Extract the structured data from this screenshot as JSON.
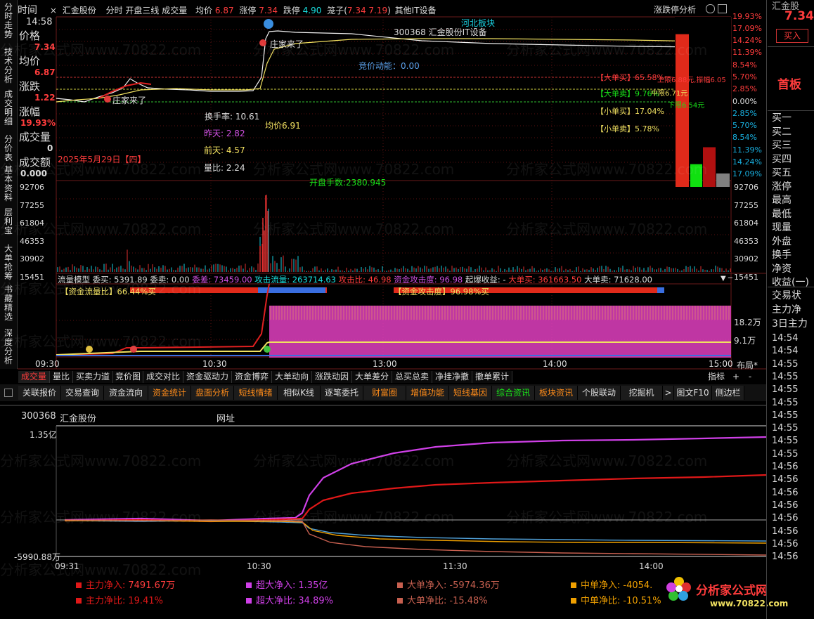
{
  "left_tabs": [
    "分时走势",
    "技术分析",
    "成交明细",
    "分价表",
    "基本资料",
    "层利宝",
    "大单抢筹",
    "书藏精选",
    "深度分析"
  ],
  "header": {
    "time_label": "时间",
    "close_icon": "×",
    "stock_name": "汇金股份",
    "chart_mode": "分时 开盘三线 成交量",
    "avg_label": "均价",
    "avg_value": "6.87",
    "limit_up_label": "涨停",
    "limit_up_value": "7.34",
    "limit_down_label": "跌停",
    "limit_down_value": "4.90",
    "cage_label": "笼子(",
    "cage_values": "7.34 7.19",
    "cage_close": ")",
    "sector": "其他IT设备",
    "right_label": "涨跌停分析"
  },
  "left_panel": {
    "time": "14:58",
    "price_label": "价格",
    "price": "7.34",
    "avg_label": "均价",
    "avg": "6.87",
    "change_label": "涨跌",
    "change": "1.22",
    "pct_label": "涨幅",
    "pct": "19.93%",
    "vol_label": "成交量",
    "vol": "0",
    "amt_label": "成交额",
    "amt": "0.000"
  },
  "price_chart": {
    "y_left": [
      "7.34",
      "6.87",
      "1.22"
    ],
    "y_right": [
      "19.93%",
      "17.09%",
      "14.24%",
      "11.39%",
      "8.54%",
      "5.70%",
      "2.85%",
      "0.00%",
      "2.85%",
      "5.70%",
      "8.54%",
      "11.39%",
      "14.24%",
      "17.09%"
    ],
    "code_label": "300368  汇金股份IT设备",
    "sector_label": "河北板块",
    "zhuangjia1": "庄家来了",
    "zhuangjia2": "庄家来了",
    "bid_momentum": "竞价动能：0.00",
    "turnover": "换手率: 10.61",
    "avg_price": "均价6.91",
    "yesterday": "昨天: 2.82",
    "day_before": "前天: 4.57",
    "ratio": "量比: 2.24",
    "date": "2025年5月29日【四】",
    "open_lots": "开盘手数:2380.945",
    "big_buy": "【大单买】65.58%",
    "big_sell": "【大单卖】9.76%",
    "small_buy": "【小单买】17.04%",
    "small_sell": "【小单卖】5.78%",
    "upper": "上限6.88元,振幅6.05",
    "middle": "中限6.71元",
    "lower": "下限6.54元",
    "bar_values": [
      65.58,
      9.76,
      17.04,
      5.78
    ],
    "bar_colors": [
      "#e02a1a",
      "#10e010",
      "#b01010",
      "#808080"
    ]
  },
  "volume_chart": {
    "y_labels": [
      "92706",
      "77255",
      "61804",
      "46353",
      "30902",
      "15451"
    ]
  },
  "flow_model": {
    "title": "流量模型",
    "wei_mai": "委买: 5391.89",
    "wei_mai2": "委卖: 0.00",
    "wei_cha": "委差: 73459.00",
    "attack_flow": "攻击流量: 263714.63",
    "attack_ratio": "攻击比: 46.98",
    "fund_attack": "资金攻击度: 96.98",
    "boom_gain": "起爆收益: -",
    "big_buy": "大单买: 361663.50",
    "big_sell": "大单卖: 71628.00",
    "flow_ratio": "【资金流量比】66.44%买",
    "attack_deg": "【资金攻击度】96.98%买",
    "y_labels": [
      "18.2万",
      "9.1万"
    ]
  },
  "time_axis": [
    "09:30",
    "10:30",
    "13:00",
    "14:00",
    "15:00"
  ],
  "layout_label": "布局*",
  "sub_tabs": [
    "成交量",
    "量比",
    "买卖力道",
    "竞价图",
    "成交对比",
    "资金驱动力",
    "资金博弈",
    "大单动向",
    "涨跌动因",
    "大单差分",
    "总买总卖",
    "净挂净撤",
    "撤单累计"
  ],
  "sub_tabs_right": [
    "指标",
    "+",
    "-"
  ],
  "func_tabs": [
    {
      "label": "关联报价",
      "style": "w"
    },
    {
      "label": "交易查询",
      "style": "w"
    },
    {
      "label": "资金流向",
      "style": "w"
    },
    {
      "label": "资金统计",
      "style": "o"
    },
    {
      "label": "盘面分析",
      "style": "o"
    },
    {
      "label": "短线情绪",
      "style": "o"
    },
    {
      "label": "相似K线",
      "style": "w"
    },
    {
      "label": "逐笔委托",
      "style": "w"
    },
    {
      "label": "财富圈",
      "style": "o"
    },
    {
      "label": "增值功能",
      "style": "o"
    },
    {
      "label": "短线基因",
      "style": "o"
    },
    {
      "label": "综合资讯",
      "style": "g"
    },
    {
      "label": "板块资讯",
      "style": "o"
    },
    {
      "label": "个股联动",
      "style": "w"
    },
    {
      "label": "挖掘机",
      "style": "w"
    },
    {
      "label": ">",
      "style": "w"
    },
    {
      "label": "图文F10",
      "style": "w"
    },
    {
      "label": "侧边栏",
      "style": "w"
    }
  ],
  "bottom": {
    "code": "300368",
    "name": "汇金股份",
    "link": "网址",
    "y_top": "1.35亿",
    "y_bottom": "-5990.88万",
    "x_labels": [
      "09:31",
      "10:30",
      "11:30",
      "14:00"
    ]
  },
  "bottom_legend": [
    {
      "label": "主力净入:",
      "value": "7491.67万",
      "color": "#e01818"
    },
    {
      "label": "超大净入:",
      "value": "1.35亿",
      "color": "#d040e8"
    },
    {
      "label": "大单净入:",
      "value": "-5974.36万",
      "color": "#c86050"
    },
    {
      "label": "中单净入:",
      "value": "-4054.",
      "color": "#f0a000"
    },
    {
      "label": "主力净比:",
      "value": "19.41%",
      "color": "#e01818"
    },
    {
      "label": "超大净比:",
      "value": "34.89%",
      "color": "#d040e8"
    },
    {
      "label": "大单净比:",
      "value": "-15.48%",
      "color": "#c86050"
    },
    {
      "label": "中单净比:",
      "value": "-10.51%",
      "color": "#f0a000"
    }
  ],
  "right_panel": {
    "top_label": "汇金股",
    "price": "7.34",
    "buy_btn": "买入",
    "top_board": "首板",
    "list": [
      "买一",
      "买二",
      "买三",
      "买四",
      "买五",
      "涨停",
      "最高",
      "最低",
      "现量",
      "外盘",
      "换手",
      "净资",
      "收益(一)"
    ],
    "section2": [
      "交易状",
      "主力净",
      "3日主力"
    ],
    "times": [
      "14:54",
      "14:54",
      "14:55",
      "14:55",
      "14:55",
      "14:55",
      "14:55",
      "14:55",
      "14:55",
      "14:55",
      "14:56",
      "14:56",
      "14:56",
      "14:56",
      "14:56",
      "14:56",
      "14:56",
      "14:56"
    ]
  },
  "watermark": "分析家公式网www.70822.com",
  "brand": {
    "name": "分析家公式网",
    "url": "www.70822.com"
  }
}
